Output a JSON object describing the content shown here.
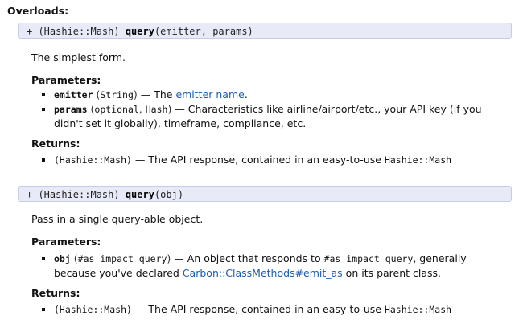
{
  "overloads_label": "Overloads:",
  "overloads": [
    {
      "sig": {
        "prefix": "+ (Hashie::Mash) ",
        "name": "query",
        "args": "(emitter, params)"
      },
      "description": "The simplest form.",
      "parameters_label": "Parameters:",
      "params": [
        {
          "name": "emitter",
          "types_open": " (",
          "type": "String",
          "types_close": ")",
          "dash": " — The ",
          "link": "emitter name",
          "tail": "."
        },
        {
          "name": "params",
          "types_open": " (",
          "opt": "optional",
          "sep": ", ",
          "type": "Hash",
          "types_close": ")",
          "desc_line1": " — Characteristics like airline/airport/etc., your API key (if you",
          "desc_line2": "didn't set it globally), timeframe, compliance, etc."
        }
      ],
      "returns_label": "Returns:",
      "returns": {
        "type": "(Hashie::Mash)",
        "text": " — The API response, contained in an easy-to-use ",
        "code": "Hashie::Mash"
      }
    },
    {
      "sig": {
        "prefix": "+ (Hashie::Mash) ",
        "name": "query",
        "args": "(obj)"
      },
      "description": "Pass in a single query-able object.",
      "parameters_label": "Parameters:",
      "params": [
        {
          "name": "obj",
          "types_open": " (",
          "type": "#as_impact_query",
          "types_close": ")",
          "desc_a": " — An object that responds to ",
          "code": "#as_impact_query",
          "desc_b": ", generally",
          "line2_a": "because you've declared ",
          "link": "Carbon::ClassMethods#emit_as",
          "line2_b": " on its parent class."
        }
      ],
      "returns_label": "Returns:",
      "returns": {
        "type": "(Hashie::Mash)",
        "text": " — The API response, contained in an easy-to-use ",
        "code": "Hashie::Mash"
      }
    }
  ]
}
